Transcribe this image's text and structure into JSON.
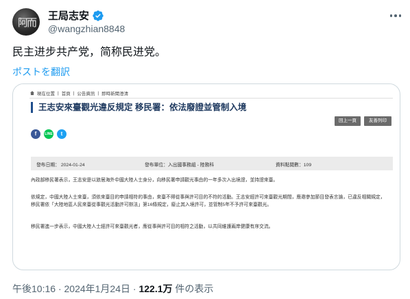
{
  "author": {
    "display_name": "王局志安",
    "handle": "@wangzhian8848",
    "avatar_glyph": "阿而"
  },
  "tweet": {
    "text": "民主进步共产党，简称民进党。",
    "translate_label": "ポストを翻訳"
  },
  "card": {
    "breadcrumb": [
      "現在位置",
      "首頁",
      "公告資訊",
      "即時新聞澄清"
    ],
    "breadcrumb_sep": "|",
    "title": "王志安來臺觀光違反規定 移民署：依法廢證並管制入境",
    "prev_label": "回上一頁",
    "print_label": "友善列印",
    "share_labels": {
      "facebook": "f",
      "line": "LINE",
      "twitter": "t"
    },
    "meta": {
      "date": "發布日期： 2024-01-24",
      "unit": "發布單位：入出國事務組 - 陸務科",
      "count": "資料點閱數：109"
    },
    "paragraphs": [
      "內政部移民署表示，王志安是以旅居海外中國大陸人士身分，向移民署申請觀光事由的一年多次入出境證，並持證來臺。",
      "依規定，中國大陸人士來臺，須依來臺目的申請相符的事由，來臺不得從事與許可目的不符的活動。王志安經許可來臺觀光期間，應邀參加節目發表言論，已違反相關規定，移民署依「大陸地區人民來臺從事觀光活動許可辦法」第16條規定，廢止其入境許可，並管制5年不予許可來臺觀光。",
      "移民署進一步表示，中國大陸人士經許可來臺觀光者，應從事與許可目的相符之活動，以共同維護兩岸健康有序交流。"
    ]
  },
  "footer": {
    "time": "午後10:16",
    "date": "2024年1月24日",
    "views": "122.1万",
    "views_label": "件の表示",
    "sep": "·"
  },
  "colors": {
    "verified": "#1d9bf0",
    "link": "#1d9bf0",
    "title_accent": "#1f4e8c"
  }
}
